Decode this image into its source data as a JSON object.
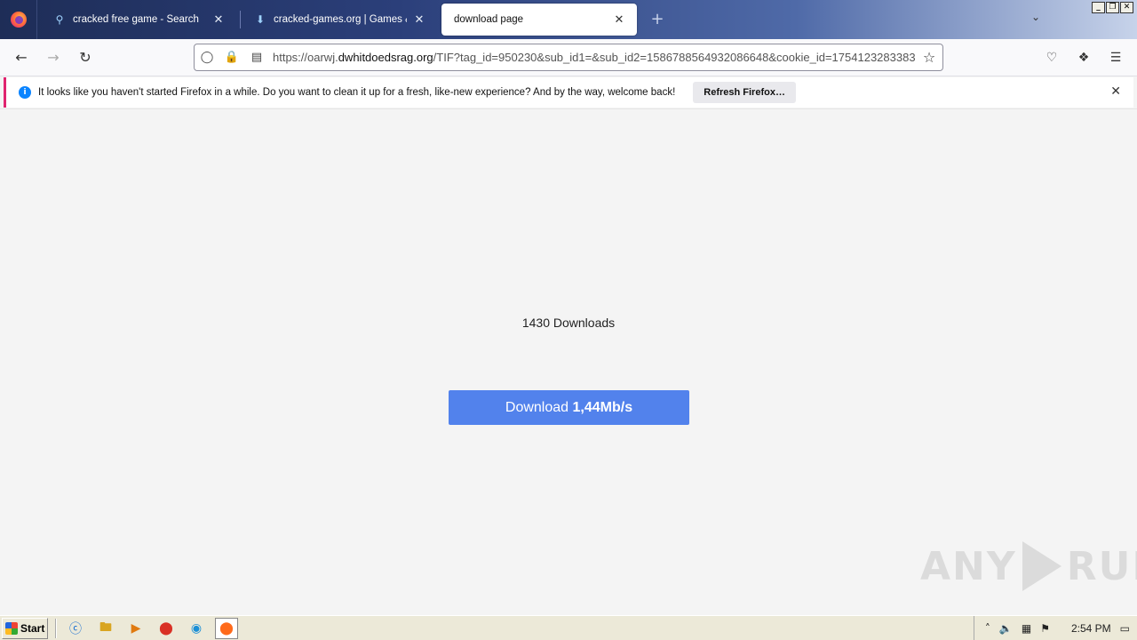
{
  "tabs": [
    {
      "title": "cracked free game - Search",
      "icon": "search-icon"
    },
    {
      "title": "cracked-games.org | Games & Soft",
      "icon": "download-arrow-icon"
    },
    {
      "title": "download page",
      "icon": ""
    }
  ],
  "nav": {
    "url_prefix": "https://oarwj.",
    "url_host": "dwhitdoedsrag.org",
    "url_path": "/TIF?tag_id=950230&sub_id1=&sub_id2=1586788564932086648&cookie_id=1754123283383"
  },
  "notification": {
    "text": "It looks like you haven't started Firefox in a while. Do you want to clean it up for a fresh, like-new experience? And by the way, welcome back!",
    "button": "Refresh Firefox…"
  },
  "page": {
    "downloads": "1430 Downloads",
    "download_label": "Download",
    "download_speed": "1,44Mb/s"
  },
  "watermark": {
    "left": "ANY",
    "right": "RUN"
  },
  "taskbar": {
    "start": "Start",
    "clock": "2:54 PM"
  }
}
